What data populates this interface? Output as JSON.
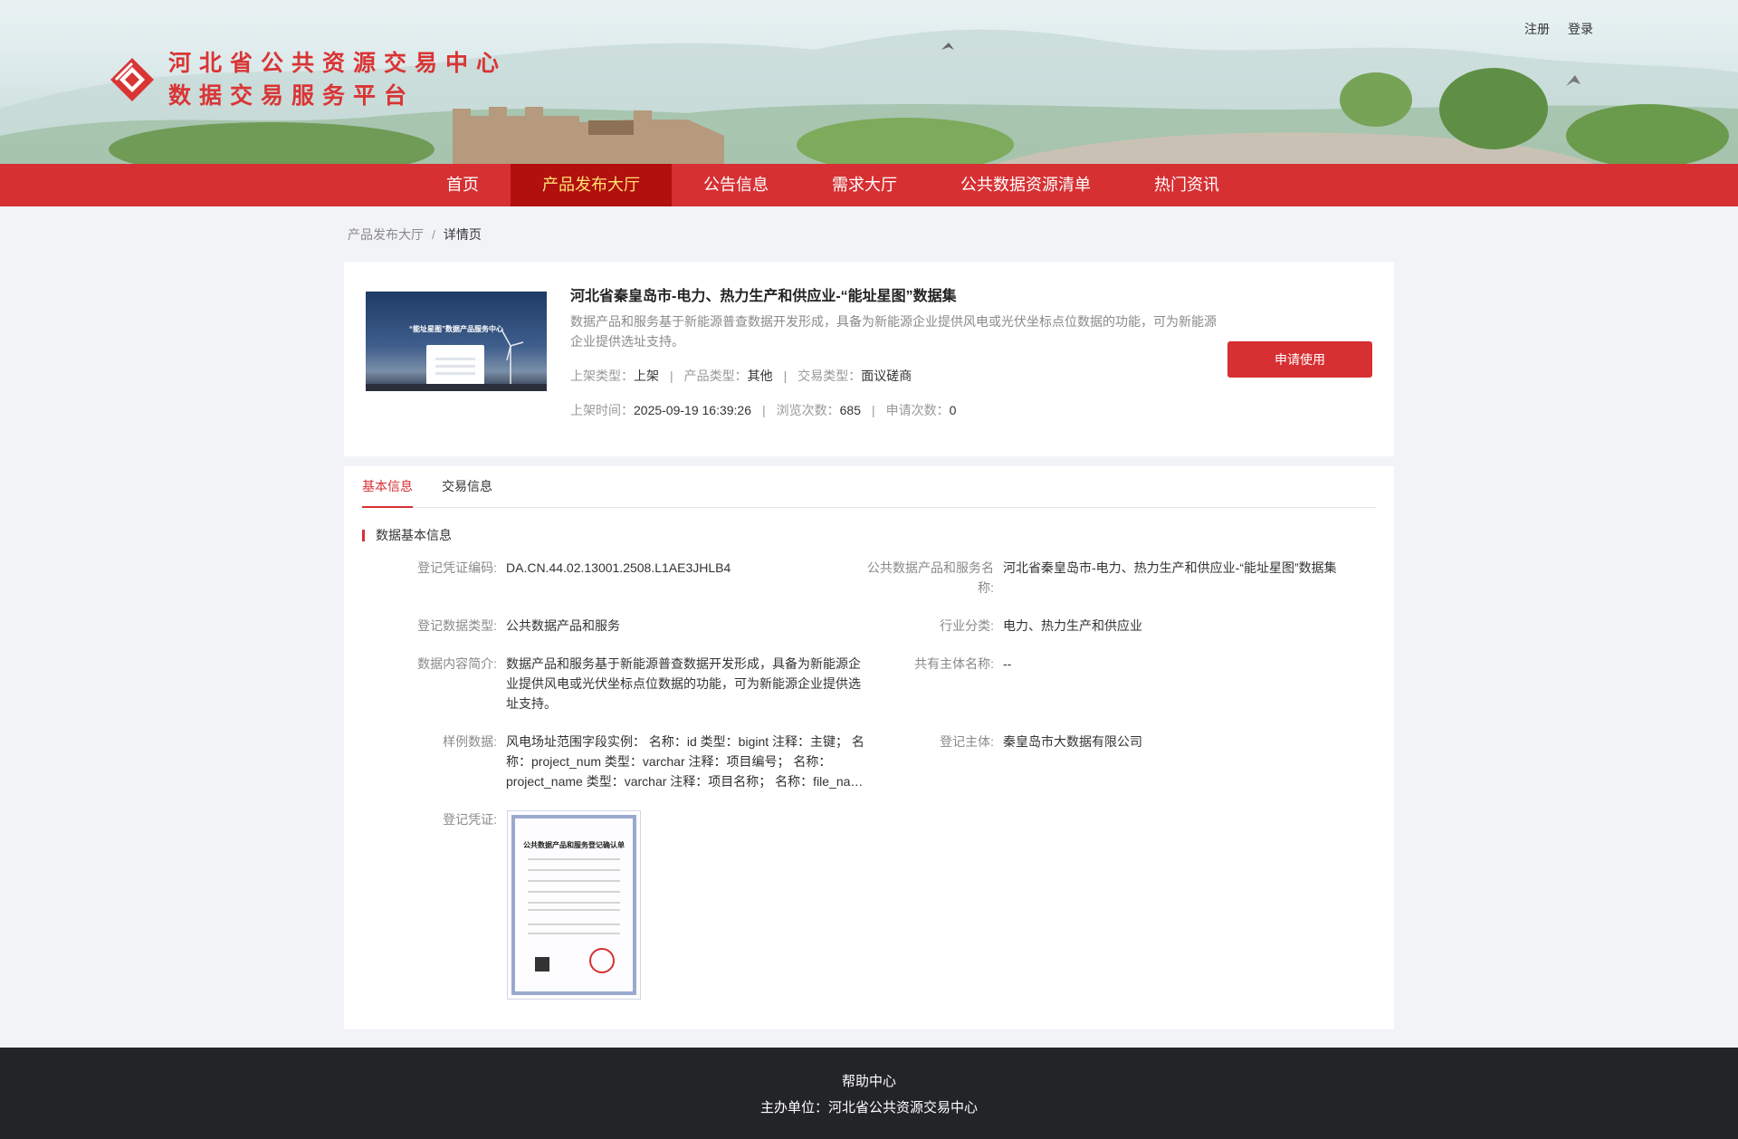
{
  "header": {
    "register_label": "注册",
    "login_label": "登录",
    "logo_line1": "河北省公共资源交易中心",
    "logo_line2": "数据交易服务平台",
    "brand_color": "#d63033"
  },
  "nav": {
    "items": [
      {
        "label": "首页"
      },
      {
        "label": "产品发布大厅",
        "active": true
      },
      {
        "label": "公告信息"
      },
      {
        "label": "需求大厅"
      },
      {
        "label": "公共数据资源清单"
      },
      {
        "label": "热门资讯"
      }
    ]
  },
  "breadcrumb": {
    "parent": "产品发布大厅",
    "separator": "/",
    "current": "详情页"
  },
  "product": {
    "thumb_headline": "“能址星图”数据产品服务中心",
    "title": "河北省秦皇岛市-电力、热力生产和供应业-“能址星图”数据集",
    "description": "数据产品和服务基于新能源普查数据开发形成，具备为新能源企业提供风电或光伏坐标点位数据的功能，可为新能源企业提供选址支持。",
    "listing_type_label": "上架类型：",
    "listing_type": "上架",
    "product_type_label": "产品类型：",
    "product_type": "其他",
    "trade_type_label": "交易类型：",
    "trade_type": "面议磋商",
    "listing_time_label": "上架时间：",
    "listing_time": "2025-09-19 16:39:26",
    "views_label": "浏览次数：",
    "views": "685",
    "applies_label": "申请次数：",
    "applies": "0",
    "apply_button": "申请使用"
  },
  "detail": {
    "tabs": [
      {
        "label": "基本信息",
        "active": true
      },
      {
        "label": "交易信息"
      }
    ],
    "section_title": "数据基本信息",
    "fields": {
      "reg_code_label": "登记凭证编码:",
      "reg_code": "DA.CN.44.02.13001.2508.L1AE3JHLB4",
      "product_name_label": "公共数据产品和服务名称:",
      "product_name": "河北省秦皇岛市-电力、热力生产和供应业-“能址星图”数据集",
      "reg_type_label": "登记数据类型:",
      "reg_type": "公共数据产品和服务",
      "industry_label": "行业分类:",
      "industry": "电力、热力生产和供应业",
      "intro_label": "数据内容简介:",
      "intro": "数据产品和服务基于新能源普查数据开发形成，具备为新能源企业提供风电或光伏坐标点位数据的功能，可为新能源企业提供选址支持。",
      "co_owner_label": "共有主体名称:",
      "co_owner": "--",
      "sample_label": "样例数据:",
      "sample": "风电场址范围字段实例： 名称：id 类型：bigint 注释：主键； 名称：project_num 类型：varchar 注释：项目编号； 名称：project_name 类型：varchar 注释：项目名称； 名称：file_na…",
      "reg_subject_label": "登记主体:",
      "reg_subject": "秦皇岛市大数据有限公司",
      "certificate_label": "登记凭证:",
      "certificate_title": "公共数据产品和服务登记确认单"
    }
  },
  "footer": {
    "help": "帮助中心",
    "organizer": "主办单位：河北省公共资源交易中心"
  }
}
